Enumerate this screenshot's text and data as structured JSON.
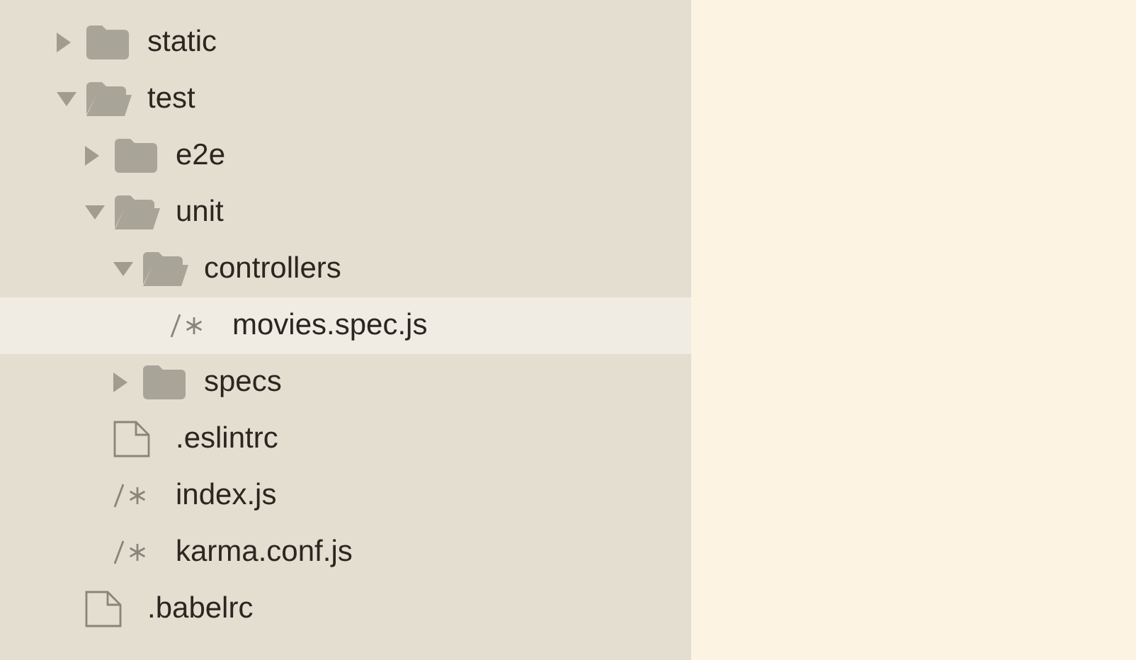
{
  "tree": [
    {
      "kind": "folder",
      "label": "static",
      "expanded": false,
      "selected": false
    },
    {
      "kind": "folder",
      "label": "test",
      "expanded": true,
      "selected": false,
      "children": [
        {
          "kind": "folder",
          "label": "e2e",
          "expanded": false,
          "selected": false
        },
        {
          "kind": "folder",
          "label": "unit",
          "expanded": true,
          "selected": false,
          "children": [
            {
              "kind": "folder",
              "label": "controllers",
              "expanded": true,
              "selected": false,
              "children": [
                {
                  "kind": "js",
                  "label": "movies.spec.js",
                  "selected": true
                }
              ]
            },
            {
              "kind": "folder",
              "label": "specs",
              "expanded": false,
              "selected": false
            }
          ]
        },
        {
          "kind": "plain",
          "label": ".eslintrc",
          "selected": false
        },
        {
          "kind": "js",
          "label": "index.js",
          "selected": false
        },
        {
          "kind": "js",
          "label": "karma.conf.js",
          "selected": false
        }
      ]
    },
    {
      "kind": "plain",
      "label": ".babelrc",
      "selected": false
    }
  ]
}
